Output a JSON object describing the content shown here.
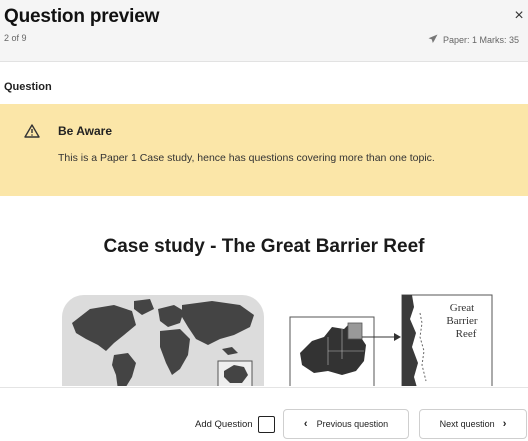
{
  "header": {
    "title": "Question preview",
    "counter": "2 of 9",
    "close_glyph": "×",
    "meta": "Paper: 1 Marks: 35",
    "meta_icon": "paper-plane-icon"
  },
  "section": {
    "label": "Question"
  },
  "alert": {
    "icon": "warning-icon",
    "title": "Be Aware",
    "body": "This is a Paper 1 Case study, hence has questions covering more than one topic.",
    "background": "#fbe6a8"
  },
  "content": {
    "case_title": "Case study - The Great Barrier Reef",
    "map_label_lines": [
      "Great",
      "Barrier",
      "Reef"
    ]
  },
  "footer": {
    "add_question_label": "Add Question",
    "add_question_checked": false,
    "prev_label": "Previous question",
    "next_label": "Next question",
    "prev_icon": "chevron-left-icon",
    "next_icon": "chevron-right-icon"
  }
}
